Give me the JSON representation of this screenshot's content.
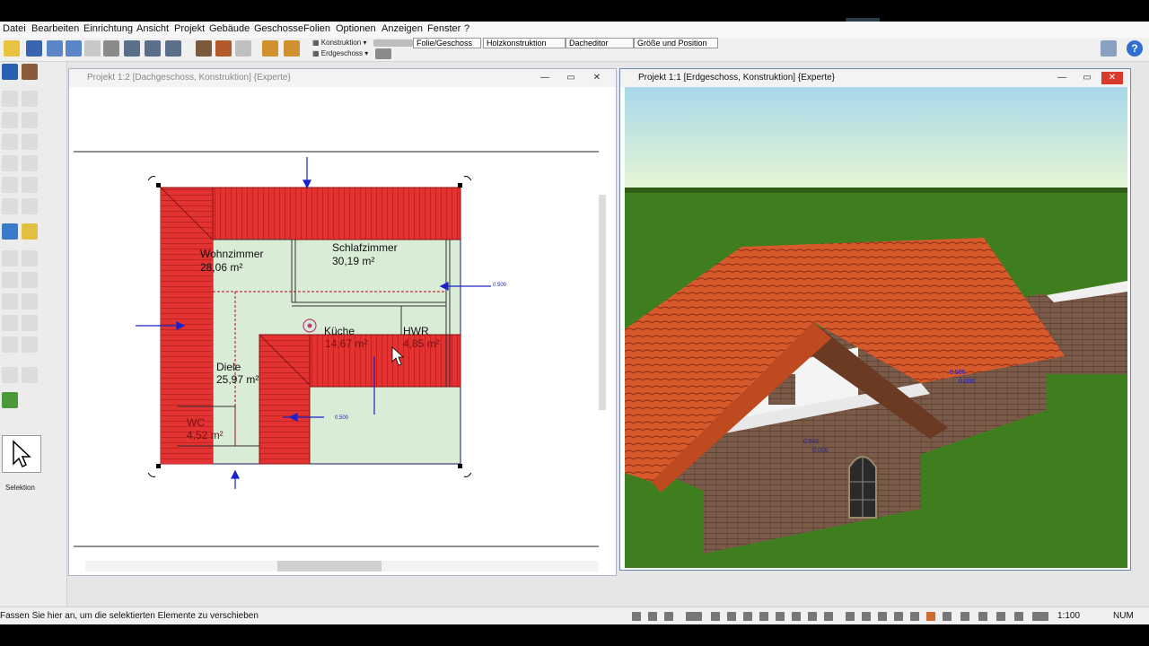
{
  "menu": [
    "Datei",
    "Bearbeiten",
    "Einrichtung",
    "Ansicht",
    "Projekt",
    "Gebäude",
    "Geschosse",
    "Folien",
    "Optionen",
    "Anzeigen",
    "Fenster",
    "?"
  ],
  "toolbar": {
    "konstruktion": "Konstruktion",
    "erdgeschoss": "Erdgeschoss",
    "tabs": [
      "Folie/Geschoss",
      "Holzkonstruktion",
      "Dacheditor",
      "Größe und Position"
    ]
  },
  "left_panel": {
    "selection_label": "Selektion"
  },
  "window_left": {
    "title": "Projekt 1:2 [Dachgeschoss, Konstruktion] {Experte}",
    "rooms": [
      {
        "name": "Wohnzimmer",
        "area": "28,06 m²"
      },
      {
        "name": "Schlafzimmer",
        "area": "30,19 m²"
      },
      {
        "name": "Küche",
        "area": "14,67 m²"
      },
      {
        "name": "HWR",
        "area": "4,85 m²"
      },
      {
        "name": "Diele",
        "area": "25,97 m²"
      },
      {
        "name": "WC",
        "area": "4,52 m²"
      }
    ],
    "dim_label": "0.500"
  },
  "window_right": {
    "title": "Projekt 1:1 [Erdgeschoss, Konstruktion] {Experte}",
    "labels": {
      "a": "0.500",
      "b": "0.000"
    }
  },
  "status": {
    "text": "Fassen Sie hier an, um die selektierten Elemente zu verschieben",
    "scale": "1:100",
    "num": "NUM"
  },
  "colors": {
    "roof_red": "#e03030",
    "room_green": "#d8ecd6",
    "grass": "#3f7e1e",
    "sky": "#bfe3ee",
    "tile": "#d45a2c",
    "brick": "#7a5a48",
    "dim_blue": "#1a22c8"
  }
}
